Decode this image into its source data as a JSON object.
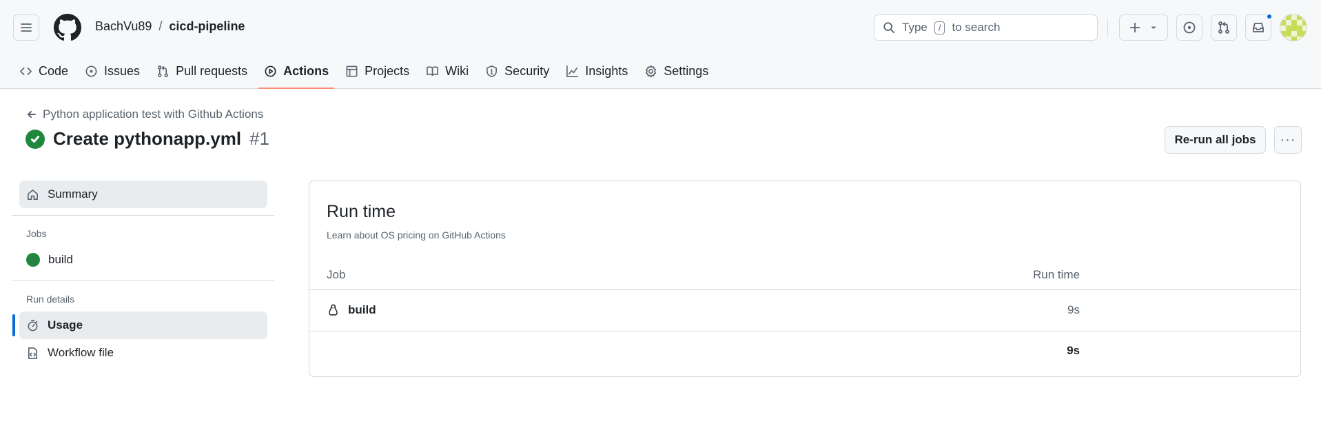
{
  "header": {
    "owner": "BachVu89",
    "separator": "/",
    "repo": "cicd-pipeline",
    "search_prefix": "Type",
    "search_key": "/",
    "search_suffix": "to search",
    "has_notification": true,
    "icons": [
      "menu-icon",
      "github-logo",
      "search-icon",
      "plus-icon",
      "triangle-down-icon",
      "issue-opened-icon",
      "pull-request-icon",
      "inbox-icon",
      "avatar"
    ]
  },
  "tabs": [
    {
      "label": "Code",
      "icon": "code-icon"
    },
    {
      "label": "Issues",
      "icon": "issue-opened-icon"
    },
    {
      "label": "Pull requests",
      "icon": "pull-request-icon"
    },
    {
      "label": "Actions",
      "icon": "play-icon",
      "active": true
    },
    {
      "label": "Projects",
      "icon": "table-icon"
    },
    {
      "label": "Wiki",
      "icon": "book-icon"
    },
    {
      "label": "Security",
      "icon": "shield-icon"
    },
    {
      "label": "Insights",
      "icon": "graph-icon"
    },
    {
      "label": "Settings",
      "icon": "gear-icon"
    }
  ],
  "run": {
    "workflow_name": "Python application test with Github Actions",
    "title": "Create pythonapp.yml",
    "number": "#1",
    "status": "success",
    "rerun_label": "Re-run all jobs",
    "more_label": "···"
  },
  "sidebar": {
    "summary_label": "Summary",
    "jobs_heading": "Jobs",
    "jobs": [
      {
        "label": "build",
        "status": "success"
      }
    ],
    "run_details_heading": "Run details",
    "usage_label": "Usage",
    "workflow_file_label": "Workflow file"
  },
  "usage": {
    "title": "Run time",
    "subtitle": "Learn about OS pricing on GitHub Actions",
    "col_job": "Job",
    "col_runtime": "Run time",
    "rows": [
      {
        "job": "build",
        "os_icon": "linux-icon",
        "time": "9s"
      }
    ],
    "total": "9s"
  },
  "colors": {
    "accent_tab": "#fd8c73",
    "success": "#1f883d",
    "selected_bar": "#0969da",
    "border": "#d1d9e0",
    "header_bg": "#f6f8fa"
  }
}
